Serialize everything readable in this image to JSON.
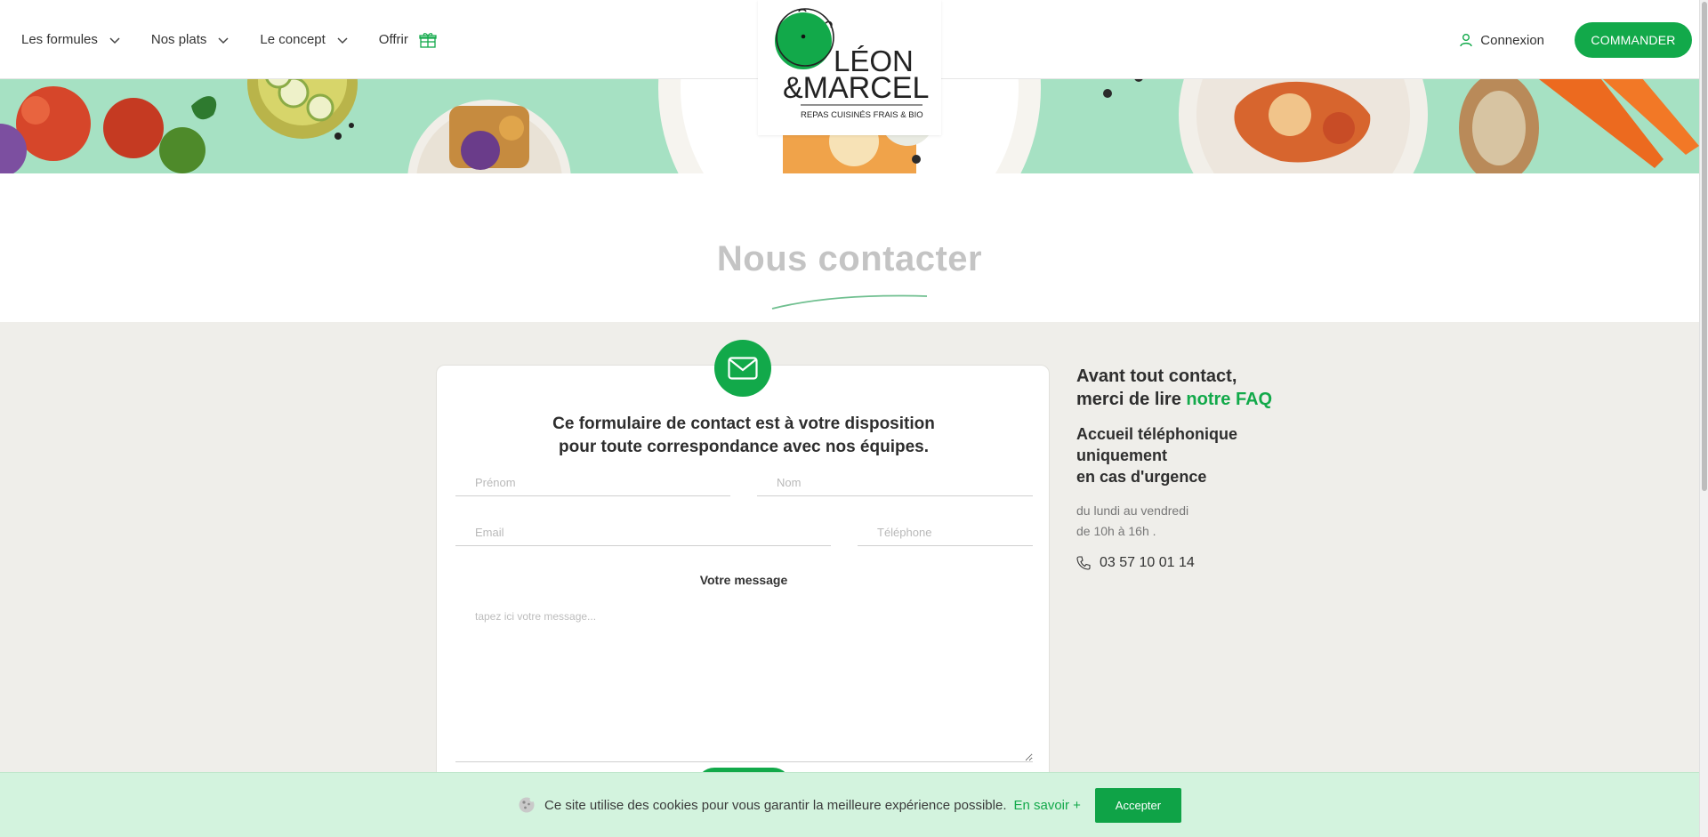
{
  "nav": {
    "items": [
      {
        "label": "Les formules"
      },
      {
        "label": "Nos plats"
      },
      {
        "label": "Le concept"
      }
    ],
    "offrir": "Offrir",
    "login": "Connexion",
    "order_button": "COMMANDER"
  },
  "logo": {
    "line1": "LÉON",
    "line2": "&MARCEL",
    "tagline": "REPAS CUISINÉS FRAIS & BIO"
  },
  "page": {
    "title": "Nous contacter"
  },
  "form": {
    "intro_line1": "Ce formulaire de contact est à votre disposition",
    "intro_line2": "pour toute correspondance avec nos équipes.",
    "firstname_placeholder": "Prénom",
    "lastname_placeholder": "Nom",
    "email_placeholder": "Email",
    "phone_placeholder": "Téléphone",
    "message_label": "Votre message",
    "message_placeholder": "tapez ici votre message..."
  },
  "side": {
    "heading_line1": "Avant tout contact,",
    "heading_line2_prefix": "merci de lire",
    "faq_link": "notre FAQ",
    "phone_heading_line1": "Accueil téléphonique",
    "phone_heading_line2": "uniquement",
    "phone_heading_line3": "en cas d'urgence",
    "hours_line1": "du lundi au vendredi",
    "hours_line2": "de 10h à 16h .",
    "phone_number": "03 57 10 01 14"
  },
  "cookie": {
    "text": "Ce site utilise des cookies pour vous garantir la meilleure expérience possible.",
    "more": "En savoir +",
    "accept": "Accepter"
  },
  "colors": {
    "brand_green": "#12a94a",
    "banner_mint": "#a6e1c3",
    "cookie_bg": "#d3f3de",
    "page_bg": "#efeeea"
  },
  "icons": [
    "chevron-down-icon",
    "gift-icon",
    "user-icon",
    "envelope-icon",
    "phone-icon",
    "cookie-icon"
  ]
}
